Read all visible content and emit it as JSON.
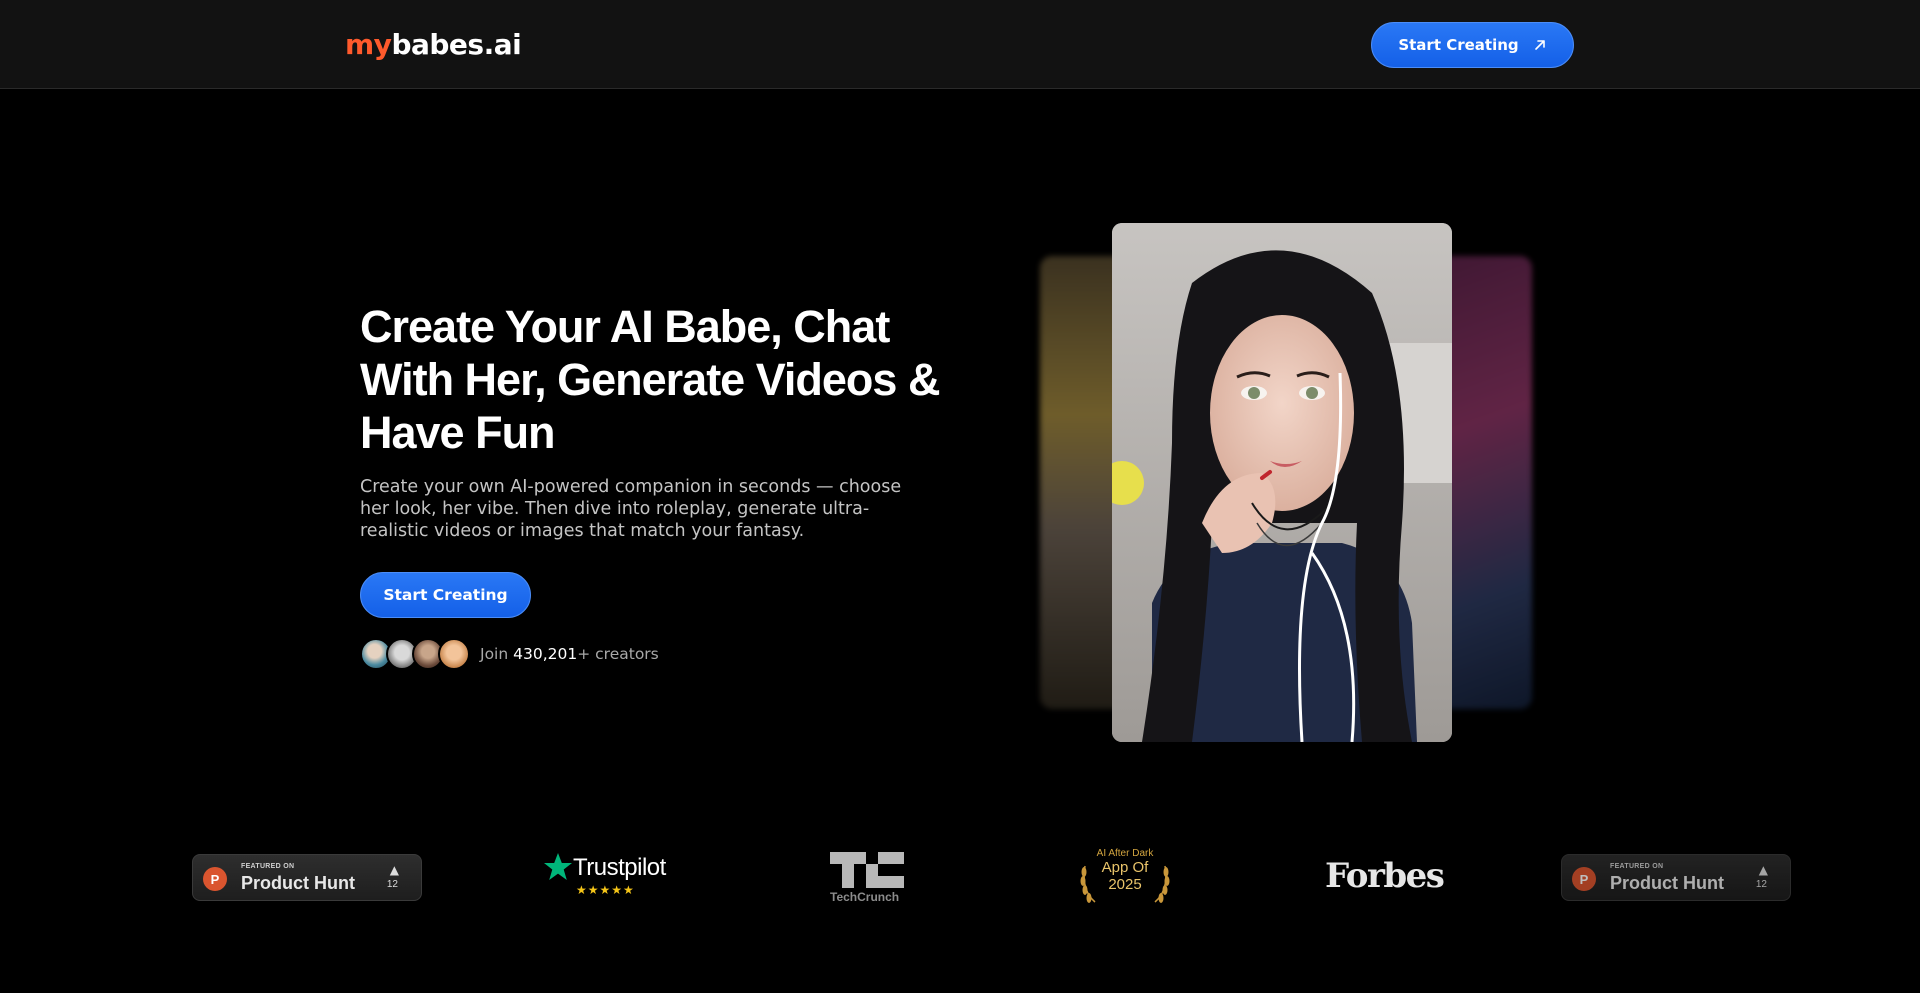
{
  "header": {
    "logo_prefix": "my",
    "logo_rest": "babes.ai",
    "cta_label": "Start Creating"
  },
  "hero": {
    "title": "Create Your AI Babe, Chat With Her, Generate Videos & Have Fun",
    "subtitle": "Create your own AI-powered companion in seconds — choose her look, her vibe. Then dive into roleplay, generate ultra-realistic videos or images that match your fantasy.",
    "cta_label": "Start Creating",
    "social_join": "Join",
    "social_count": "430,201",
    "social_suffix": "+ creators"
  },
  "badges": {
    "product_hunt_left": {
      "featured": "FEATURED ON",
      "name": "Product Hunt",
      "arrow": "▲",
      "votes": "12"
    },
    "trustpilot": {
      "name": "Trustpilot",
      "rating": "★★★★★"
    },
    "techcrunch": {
      "name": "TechCrunch"
    },
    "award": {
      "line1": "AI After Dark",
      "line2": "App Of",
      "line3": "2025"
    },
    "forbes": {
      "name": "Forbes"
    },
    "product_hunt_right": {
      "featured": "FEATURED ON",
      "name": "Product Hunt",
      "arrow": "▲",
      "votes": "12"
    }
  },
  "colors": {
    "accent_blue": "#1f6ff0",
    "logo_orange": "#ff5a2c",
    "trustpilot_green": "#00b67a",
    "product_hunt_orange": "#da552f",
    "award_gold": "#d4a640"
  },
  "icons": {
    "header_cta_icon": "arrow-up-right-icon",
    "product_hunt_logo": "product-hunt-p-icon",
    "trustpilot_logo": "trustpilot-star-icon"
  }
}
